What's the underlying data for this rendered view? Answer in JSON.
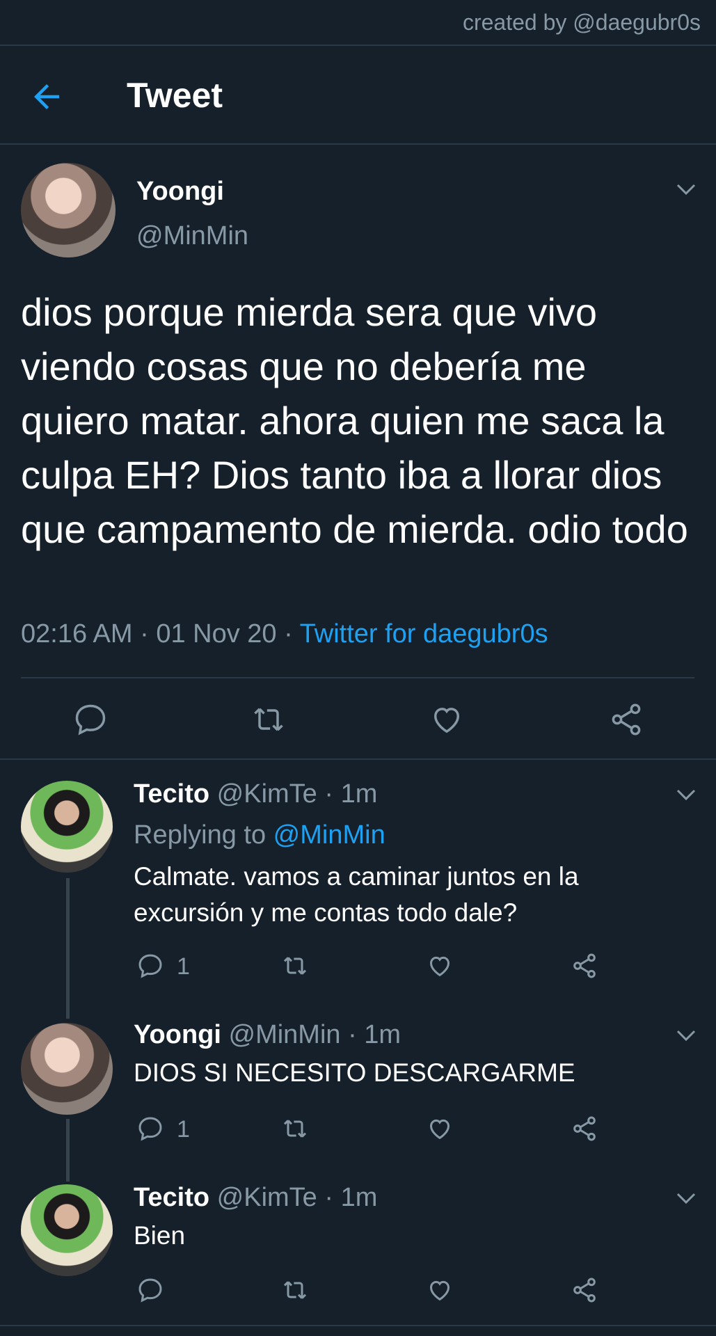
{
  "credit": "created by @daegubr0s",
  "header": {
    "title": "Tweet"
  },
  "main_tweet": {
    "name": "Yoongi",
    "handle": "@MinMin",
    "text": "dios porque mierda sera que vivo viendo cosas que no debería me quiero matar. ahora quien me saca la culpa EH? Dios tanto iba a llorar dios que campamento de mierda. odio todo",
    "timestamp": "02:16 AM · 01 Nov 20 · ",
    "source": "Twitter for daegubr0s"
  },
  "replies": [
    {
      "name": "Tecito",
      "meta": " @KimTe · 1m",
      "replying_label": "Replying to ",
      "replying_to": "@MinMin",
      "text": "Calmate. vamos a caminar juntos en la excursión y me contas todo dale?",
      "reply_count": "1"
    },
    {
      "name": "Yoongi",
      "meta": " @MinMin · 1m",
      "text": "DIOS SI NECESITO DESCARGARME",
      "reply_count": "1"
    },
    {
      "name": "Tecito",
      "meta": " @KimTe · 1m",
      "text": "Bien"
    }
  ],
  "colors": {
    "background": "#15202b",
    "accent": "#1da1f2",
    "muted": "#8899a6",
    "divider": "#2b3845"
  },
  "icons": [
    "back-arrow-icon",
    "chevron-down-icon",
    "reply-icon",
    "retweet-icon",
    "like-icon",
    "share-icon"
  ]
}
